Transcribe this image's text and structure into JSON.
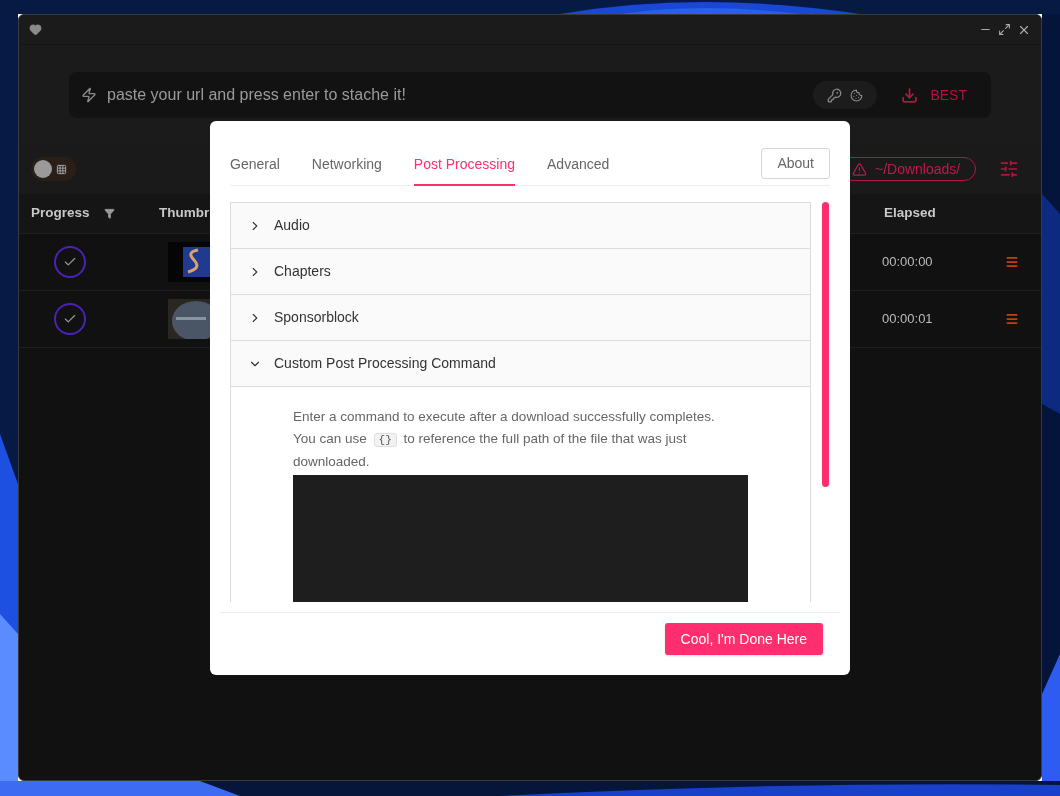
{
  "url_bar": {
    "placeholder": "paste your url and press enter to stache it!",
    "quality": "BEST"
  },
  "view_toggle": {
    "on": false
  },
  "download_location": {
    "path": "~/Downloads/",
    "warning": true
  },
  "table": {
    "columns": [
      {
        "label": "Progress",
        "kind": "filterable"
      },
      {
        "label": "Thumbr",
        "kind": "plain"
      },
      {
        "label": "Elapsed",
        "kind": "plain"
      }
    ],
    "rows": [
      {
        "done": true,
        "elapsed": "00:00:00"
      },
      {
        "done": true,
        "elapsed": "00:00:01"
      }
    ]
  },
  "dialog": {
    "tabs": [
      {
        "label": "General",
        "selected": false
      },
      {
        "label": "Networking",
        "selected": false
      },
      {
        "label": "Post Processing",
        "selected": true
      },
      {
        "label": "Advanced",
        "selected": false
      }
    ],
    "about": "About",
    "sections": [
      {
        "title": "Audio",
        "expanded": false
      },
      {
        "title": "Chapters",
        "expanded": false
      },
      {
        "title": "Sponsorblock",
        "expanded": false
      },
      {
        "title": "Custom Post Processing Command",
        "expanded": true
      }
    ],
    "description": {
      "before": "Enter a command to execute after a download successfully completes. You can use",
      "code": "{}",
      "after": "to reference the full path of the file that was just downloaded."
    },
    "done_button": "Cool, I'm Done Here"
  }
}
